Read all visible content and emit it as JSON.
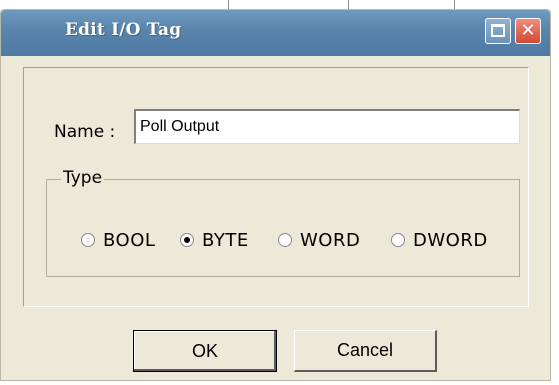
{
  "dialog": {
    "title": "Edit I/O Tag",
    "close_glyph": "✕"
  },
  "name_field": {
    "label": "Name :",
    "value": "Poll Output"
  },
  "type_group": {
    "legend": "Type",
    "options": [
      {
        "label": "BOOL",
        "selected": false
      },
      {
        "label": "BYTE",
        "selected": true
      },
      {
        "label": "WORD",
        "selected": false
      },
      {
        "label": "DWORD",
        "selected": false
      }
    ]
  },
  "buttons": {
    "ok_label": "OK",
    "cancel_label": "Cancel"
  },
  "icons": {
    "maximize": "maximize-icon",
    "close": "close-icon"
  },
  "colors": {
    "title_bar": "#5a86ad",
    "dialog_bg": "#ece9d8",
    "close_button": "#cf4a34"
  }
}
